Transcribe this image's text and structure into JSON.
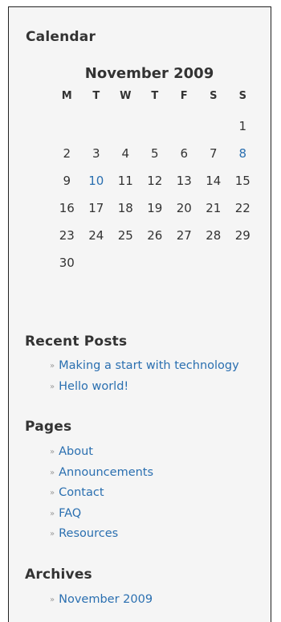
{
  "calendar": {
    "title": "Calendar",
    "caption": "November 2009",
    "weekdays": [
      "M",
      "T",
      "W",
      "T",
      "F",
      "S",
      "S"
    ],
    "weeks": [
      [
        "",
        "",
        "",
        "",
        "",
        "",
        "1"
      ],
      [
        "2",
        "3",
        "4",
        "5",
        "6",
        "7",
        "8"
      ],
      [
        "9",
        "10",
        "11",
        "12",
        "13",
        "14",
        "15"
      ],
      [
        "16",
        "17",
        "18",
        "19",
        "20",
        "21",
        "22"
      ],
      [
        "23",
        "24",
        "25",
        "26",
        "27",
        "28",
        "29"
      ],
      [
        "30",
        "",
        "",
        "",
        "",
        "",
        ""
      ]
    ],
    "linked_days": [
      "8",
      "10"
    ]
  },
  "recent_posts": {
    "title": "Recent Posts",
    "items": [
      "Making a start with technology",
      "Hello world!"
    ]
  },
  "pages": {
    "title": "Pages",
    "items": [
      "About",
      "Announcements",
      "Contact",
      "FAQ",
      "Resources"
    ]
  },
  "archives": {
    "title": "Archives",
    "items": [
      "November 2009"
    ]
  },
  "bullet": "»",
  "colors": {
    "link": "#2a6fb0",
    "text": "#333333",
    "background": "#f5f5f5",
    "border": "#222222"
  }
}
